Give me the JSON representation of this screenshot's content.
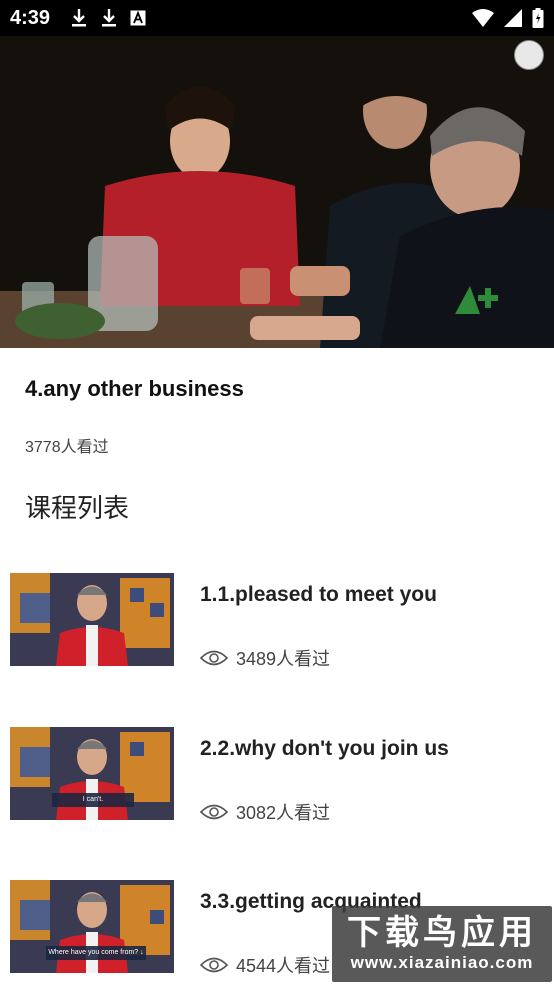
{
  "status_bar": {
    "time": "4:39"
  },
  "video": {
    "title": "4.any other business",
    "views": "3778人看过"
  },
  "section": {
    "title": "课程列表"
  },
  "courses": [
    {
      "title": "1.1.pleased to meet you",
      "views": "3489人看过",
      "subtitle": ""
    },
    {
      "title": "2.2.why don't you join us",
      "views": "3082人看过",
      "subtitle": "I can't."
    },
    {
      "title": "3.3.getting acquainted",
      "views": "4544人看过",
      "subtitle": "Where have you come from? ↓"
    }
  ],
  "watermark": {
    "main": "下载鸟应用",
    "sub": "www.xiazainiao.com"
  }
}
